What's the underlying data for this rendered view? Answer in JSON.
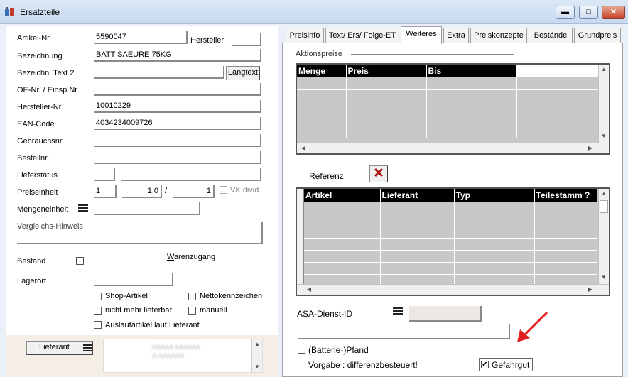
{
  "window": {
    "title": "Ersatzteile",
    "minimize_glyph": "▬",
    "maximize_glyph": "□",
    "close_glyph": "✕"
  },
  "left": {
    "artikel_nr_label": "Artikel-Nr",
    "artikel_nr_value": "5590047",
    "hersteller_button": "Hersteller",
    "bezeichnung_label": "Bezeichnung",
    "bezeichnung_value": "BATT SAEURE 75KG",
    "bezeichn_text2_label": "Bezeichn. Text 2",
    "bezeichn_text2_value": "",
    "langtext_button": "Langtext",
    "oe_nr_label": "OE-Nr. / Einsp.Nr",
    "oe_nr_value": "",
    "hersteller_nr_label": "Hersteller-Nr.",
    "hersteller_nr_value": "10010229",
    "ean_label": "EAN-Code",
    "ean_value": "4034234009726",
    "gebrauchsnr_label": "Gebrauchsnr.",
    "bestellnr_label": "Bestellnr.",
    "lieferstatus_label": "Lieferstatus",
    "preiseinheit_label": "Preiseinheit",
    "preiseinheit_value1": "1",
    "preiseinheit_value2": "1,0",
    "preiseinheit_slash": "/",
    "preiseinheit_value3": "1",
    "vk_divid_label": "VK divid.",
    "mengeneinheit_label": "Mengeneinheit",
    "vergleichs_label": "Vergleichs-Hinweis",
    "bestand_label": "Bestand",
    "warenzugang_label": "Warenzugang",
    "lagerort_label": "Lagerort",
    "shop_artikel_label": "Shop-Artikel",
    "nettokennzeichen_label": "Nettokennzeichen",
    "nicht_lieferbar_label": "nicht mehr lieferbar",
    "manuell_label": "manuell",
    "auslauf_label": "Auslaufartikel laut Lieferant",
    "lieferant_button": "Lieferant",
    "lieferant_blurred_line1": "HAAAA AAAAAA",
    "lieferant_blurred_line2": "A-AAAAAA"
  },
  "tabs": [
    {
      "label": "Preisinfo"
    },
    {
      "label": "Text/ Ers/ Folge-ET"
    },
    {
      "label": "Weiteres"
    },
    {
      "label": "Extra"
    },
    {
      "label": "Preiskonzepte"
    },
    {
      "label": "Bestände"
    },
    {
      "label": "Grundpreis"
    }
  ],
  "right": {
    "aktionspreise_label": "Aktionspreise",
    "aktions_columns": [
      "Menge",
      "Preis",
      "Bis",
      ""
    ],
    "referenz_label": "Referenz",
    "referenz_columns": [
      "Artikel",
      "Lieferant",
      "Typ",
      "Teilestamm ?"
    ],
    "asa_label": "ASA-Dienst-ID",
    "batterie_pfand_label": "(Batterie-)Pfand",
    "vorgabe_label": "Vorgabe : differenzbesteuert!",
    "gefahrgut_label": "Gefahrgut",
    "gefahrgut_checked": "✔"
  },
  "colors": {
    "accent_red": "#e02020"
  }
}
